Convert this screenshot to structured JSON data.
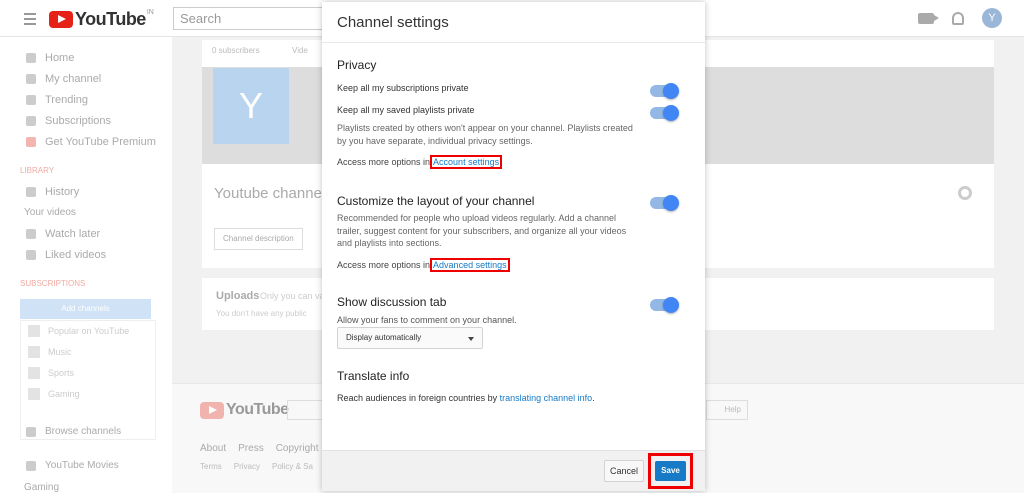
{
  "header": {
    "logo_text": "YouTube",
    "logo_region": "IN",
    "search_placeholder": "Search",
    "avatar_letter": "Y"
  },
  "sidebar": {
    "items": [
      {
        "label": "Home",
        "icon": "home-icon"
      },
      {
        "label": "My channel",
        "icon": "person-icon"
      },
      {
        "label": "Trending",
        "icon": "flame-icon"
      },
      {
        "label": "Subscriptions",
        "icon": "subscriptions-icon"
      },
      {
        "label": "Get YouTube Premium",
        "icon": "youtube-icon"
      }
    ],
    "library_heading": "LIBRARY",
    "library_items": [
      {
        "label": "History",
        "icon": "hourglass-icon"
      }
    ],
    "your_videos": "Your videos",
    "library_items2": [
      {
        "label": "Watch later",
        "icon": "clock-icon"
      },
      {
        "label": "Liked videos",
        "icon": "thumbs-up-icon"
      }
    ],
    "subscriptions_heading": "SUBSCRIPTIONS",
    "add_channels": "Add channels",
    "subscriptions": [
      "Popular on YouTube",
      "Music",
      "Sports",
      "Gaming"
    ],
    "browse_channels": "Browse channels",
    "youtube_movies": "YouTube Movies",
    "gaming": "Gaming"
  },
  "channel": {
    "subscribers": "0 subscribers",
    "videos_tab": "Vide",
    "avatar_letter": "Y",
    "name": "Youtube channe",
    "description_button": "Channel description"
  },
  "uploads": {
    "title": "Uploads",
    "subtitle": "Only you can va",
    "empty": "You don't have any public"
  },
  "footer": {
    "logo_text": "YouTube",
    "help": "Help",
    "links": [
      "About",
      "Press",
      "Copyright"
    ],
    "links2": [
      "Terms",
      "Privacy",
      "Policy & Sa"
    ]
  },
  "dialog": {
    "title": "Channel settings",
    "privacy": {
      "title": "Privacy",
      "subs_private": "Keep all my subscriptions private",
      "playlists_private": "Keep all my saved playlists private",
      "playlists_desc": "Playlists created by others won't appear on your channel. Playlists created by you have separate, individual privacy settings.",
      "more_prefix": "Access more options in",
      "more_link": "Account settings"
    },
    "layout": {
      "title": "Customize the layout of your channel",
      "desc": "Recommended for people who upload videos regularly. Add a channel trailer, suggest content for your subscribers, and organize all your videos and playlists into sections.",
      "more_prefix": "Access more options in",
      "more_link": "Advanced settings"
    },
    "discussion": {
      "title": "Show discussion tab",
      "desc": "Allow your fans to comment on your channel.",
      "select_value": "Display automatically"
    },
    "translate": {
      "title": "Translate info",
      "text": "Reach audiences in foreign countries by",
      "link": "translating channel info",
      "suffix": "."
    },
    "cancel": "Cancel",
    "save": "Save"
  },
  "colors": {
    "toggle_on": "#4285f4",
    "link": "#167ac6",
    "save_button": "#167ac6",
    "highlight": "#ee0000"
  }
}
